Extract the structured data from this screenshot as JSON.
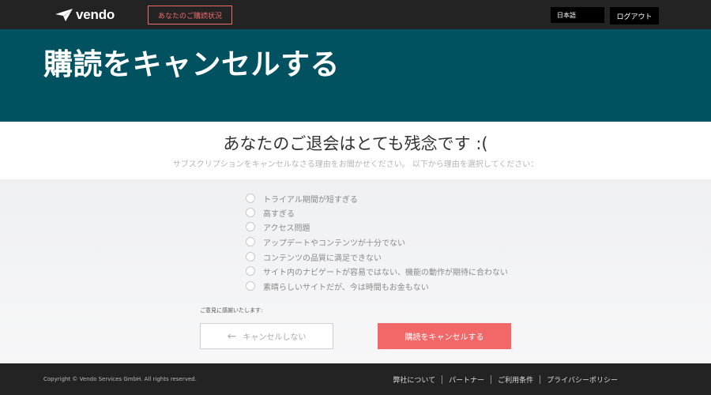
{
  "header": {
    "logo_text": "vendo",
    "subscription_status_link": "あなたのご購読状況",
    "language": "日本語",
    "logout_label": "ログアウト"
  },
  "hero": {
    "title": "購読をキャンセルする"
  },
  "sorry": {
    "heading": "あなたのご退会はとても残念です :(",
    "subtext": "サブスクリプションをキャンセルなさる理由をお聞かせください。 以下から理由を選択してください："
  },
  "reasons": [
    "トライアル期間が短すぎる",
    "高すぎる",
    "アクセス問題",
    "アップデートやコンテンツが十分でない",
    "コンテンツの品質に満足できない",
    "サイト内のナビゲートが容易ではない、機能の動作が期待に合わない",
    "素晴らしいサイトだが、今は時間もお金もない"
  ],
  "feedback_label": "ご意見に感謝いたします:",
  "actions": {
    "keep_label": "キャンセルしない",
    "cancel_label": "購読をキャンセルする"
  },
  "footer": {
    "copyright": "Copyright © Vendo Services GmbH. All rights reserved.",
    "links": [
      "弊社について",
      "パートナー",
      "ご利用条件",
      "プライバシーポリシー"
    ]
  },
  "colors": {
    "nav_bg": "#232323",
    "hero_bg": "#005260",
    "accent": "#f26868"
  }
}
